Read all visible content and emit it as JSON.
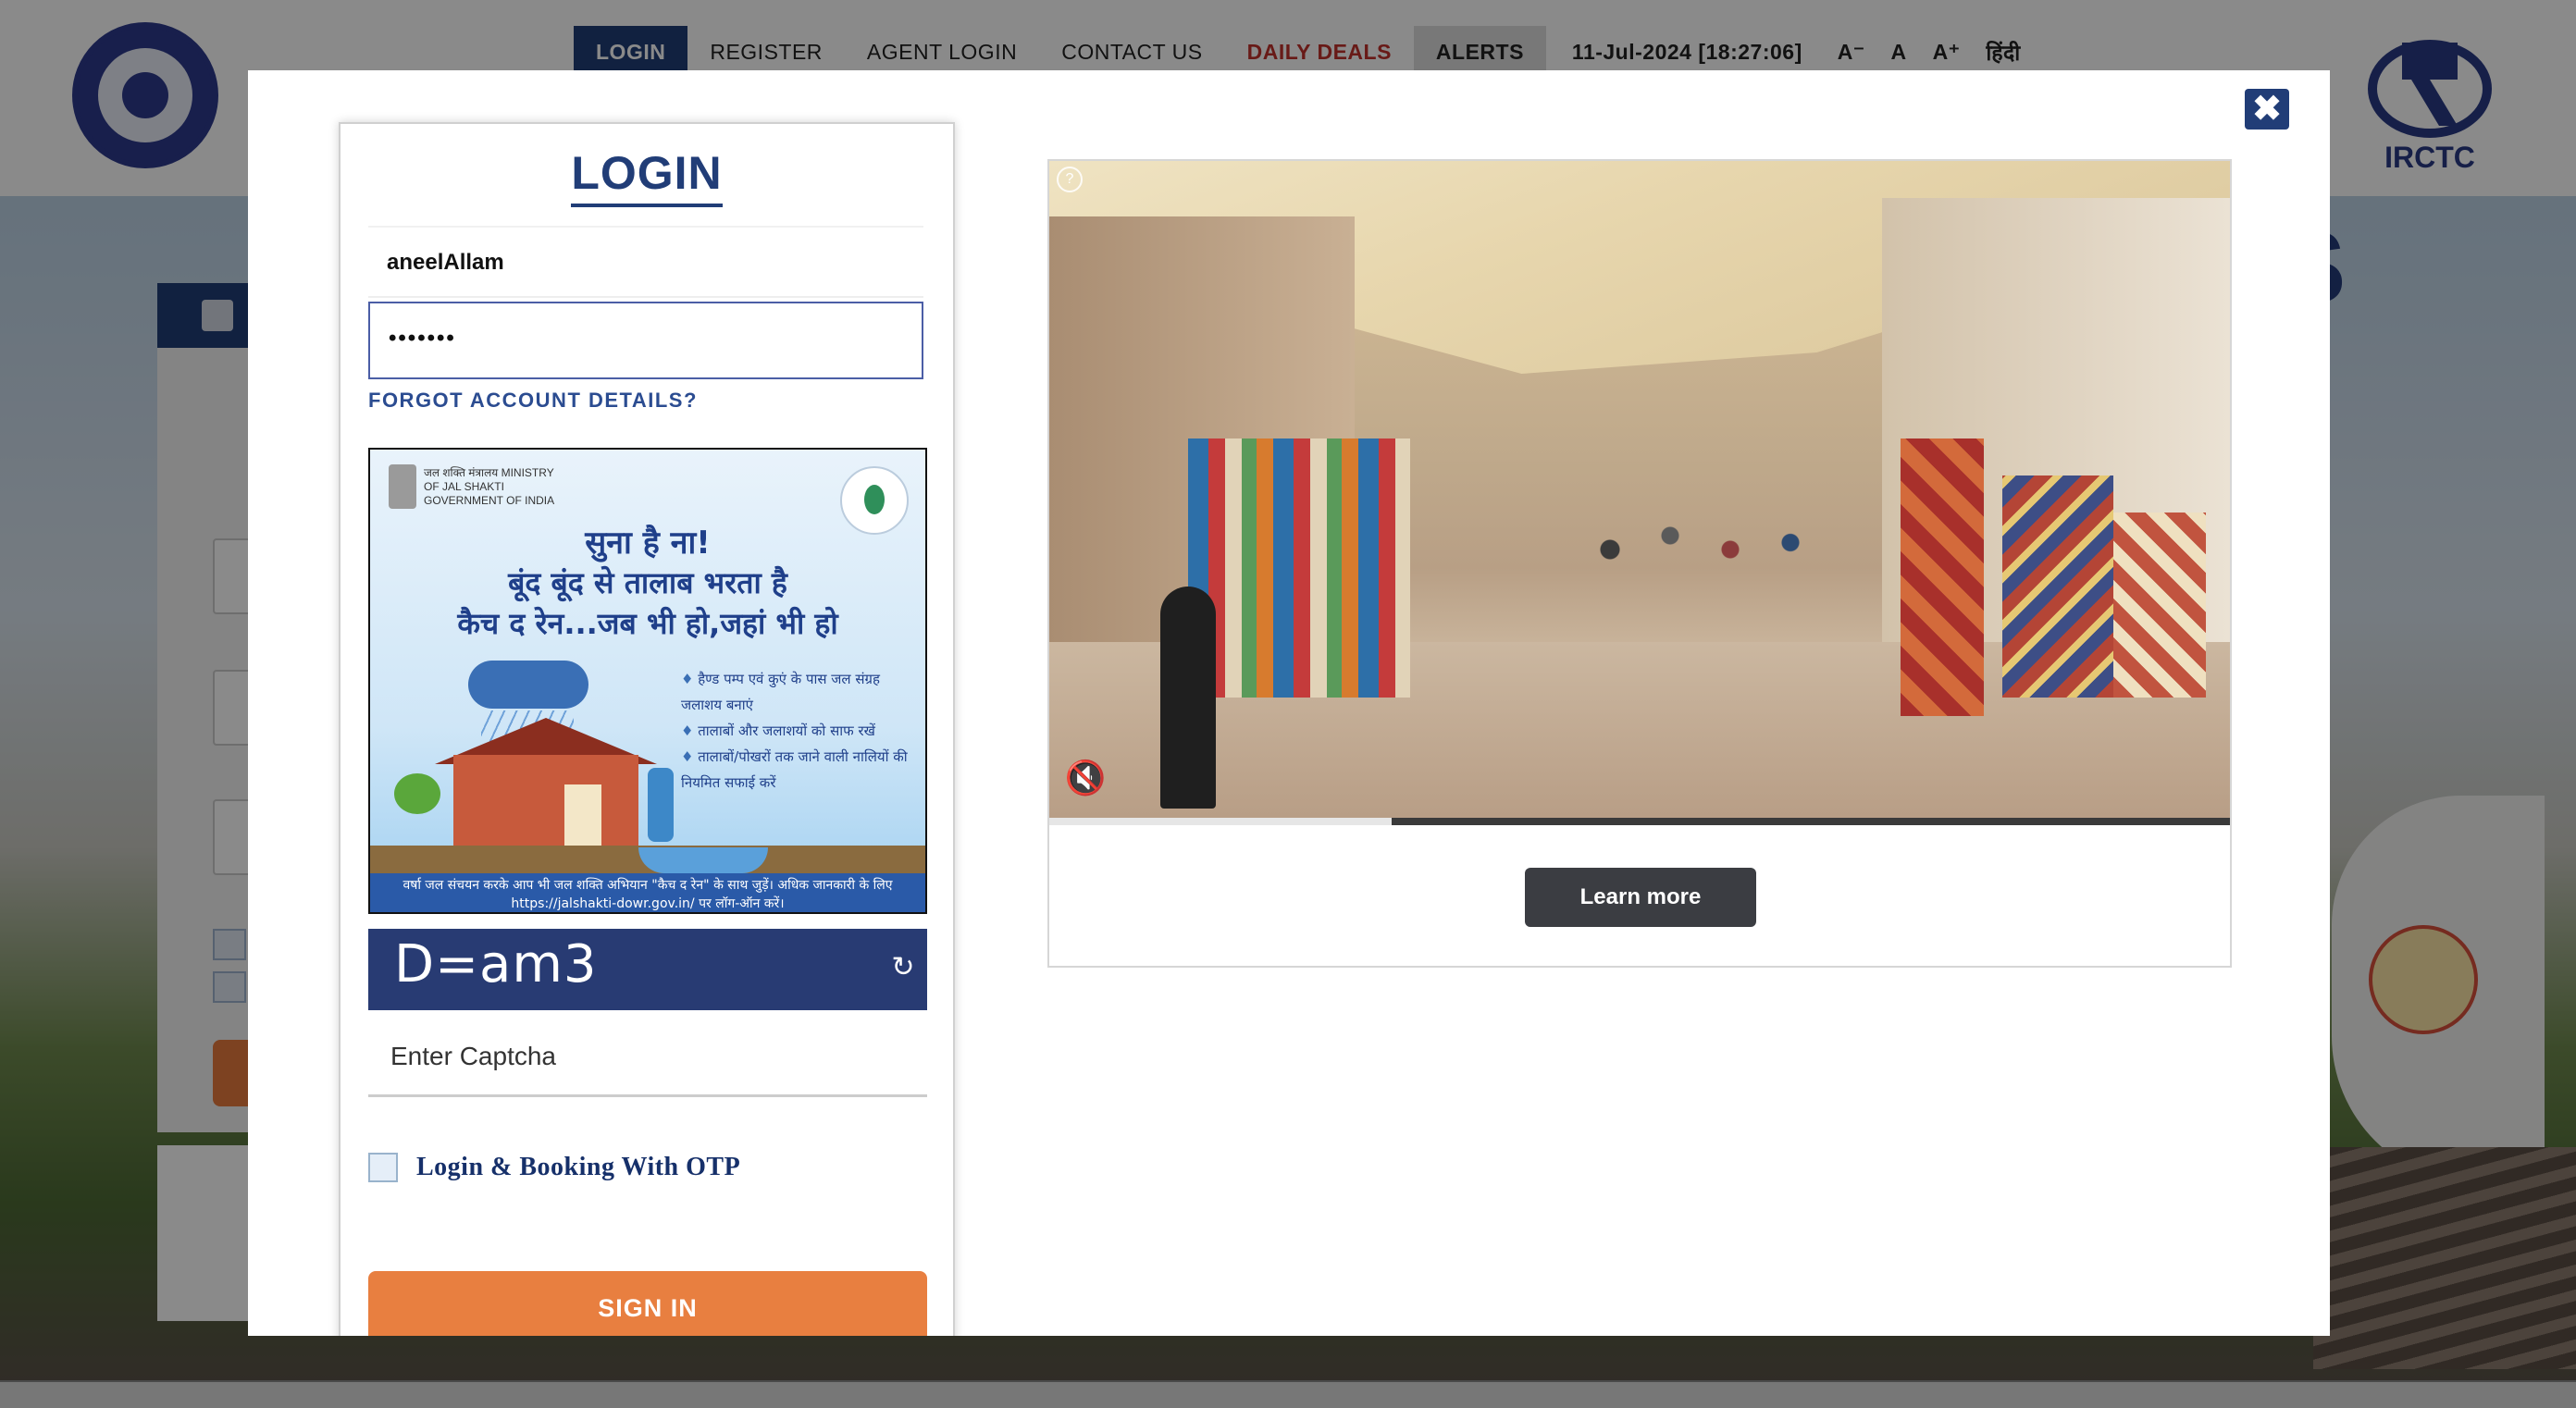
{
  "header": {
    "nav": [
      {
        "label": "LOGIN"
      },
      {
        "label": "REGISTER"
      },
      {
        "label": "AGENT LOGIN"
      },
      {
        "label": "CONTACT US"
      },
      {
        "label": "DAILY DEALS"
      },
      {
        "label": "ALERTS"
      }
    ],
    "datetime": "11-Jul-2024 [18:27:06]",
    "font_controls": [
      "A⁻",
      "A",
      "A⁺"
    ],
    "language": "हिंदी",
    "irctc_logo_text": "IRCTC"
  },
  "background": {
    "hero_letter": "S"
  },
  "login": {
    "title": "LOGIN",
    "username_value": "aneelAllam",
    "password_value": "•••••••",
    "forgot_label": "FORGOT ACCOUNT DETAILS?",
    "captcha_text": "D=am3",
    "captcha_placeholder": "Enter Captcha",
    "otp_label": "Login & Booking With OTP",
    "otp_checked": false,
    "signin_label": "SIGN IN"
  },
  "promo": {
    "ministry_text": "जल शक्ति मंत्रालय MINISTRY OF JAL SHAKTI GOVERNMENT OF INDIA",
    "line1": "सुना है ना!",
    "line2": "बूंद बूंद से तालाब भरता है",
    "line3": "कैच द रेन...जब भी हो,जहां भी हो",
    "bullets": [
      "हैण्ड पम्प एवं कुएं के पास जल संग्रह जलाशय बनाएं",
      "तालाबों और जलाशयों को साफ रखें",
      "तालाबों/पोखरों तक जाने वाली नालियों की नियमित सफाई करें"
    ],
    "footer": "वर्षा जल संचयन करके आप भी जल शक्ति अभियान \"कैच द रेन\" के साथ जुड़ें। अधिक जानकारी के लिए https://jalshakti-dowr.gov.in/ पर लॉग-ऑन करें।"
  },
  "ad": {
    "help_glyph": "?",
    "progress": 0.29,
    "cta_label": "Learn more"
  },
  "modal": {
    "close_glyph": "✖"
  },
  "colors": {
    "brand_navy": "#213d77",
    "signin_orange": "#e87f40",
    "deals_red": "#c0312b"
  }
}
